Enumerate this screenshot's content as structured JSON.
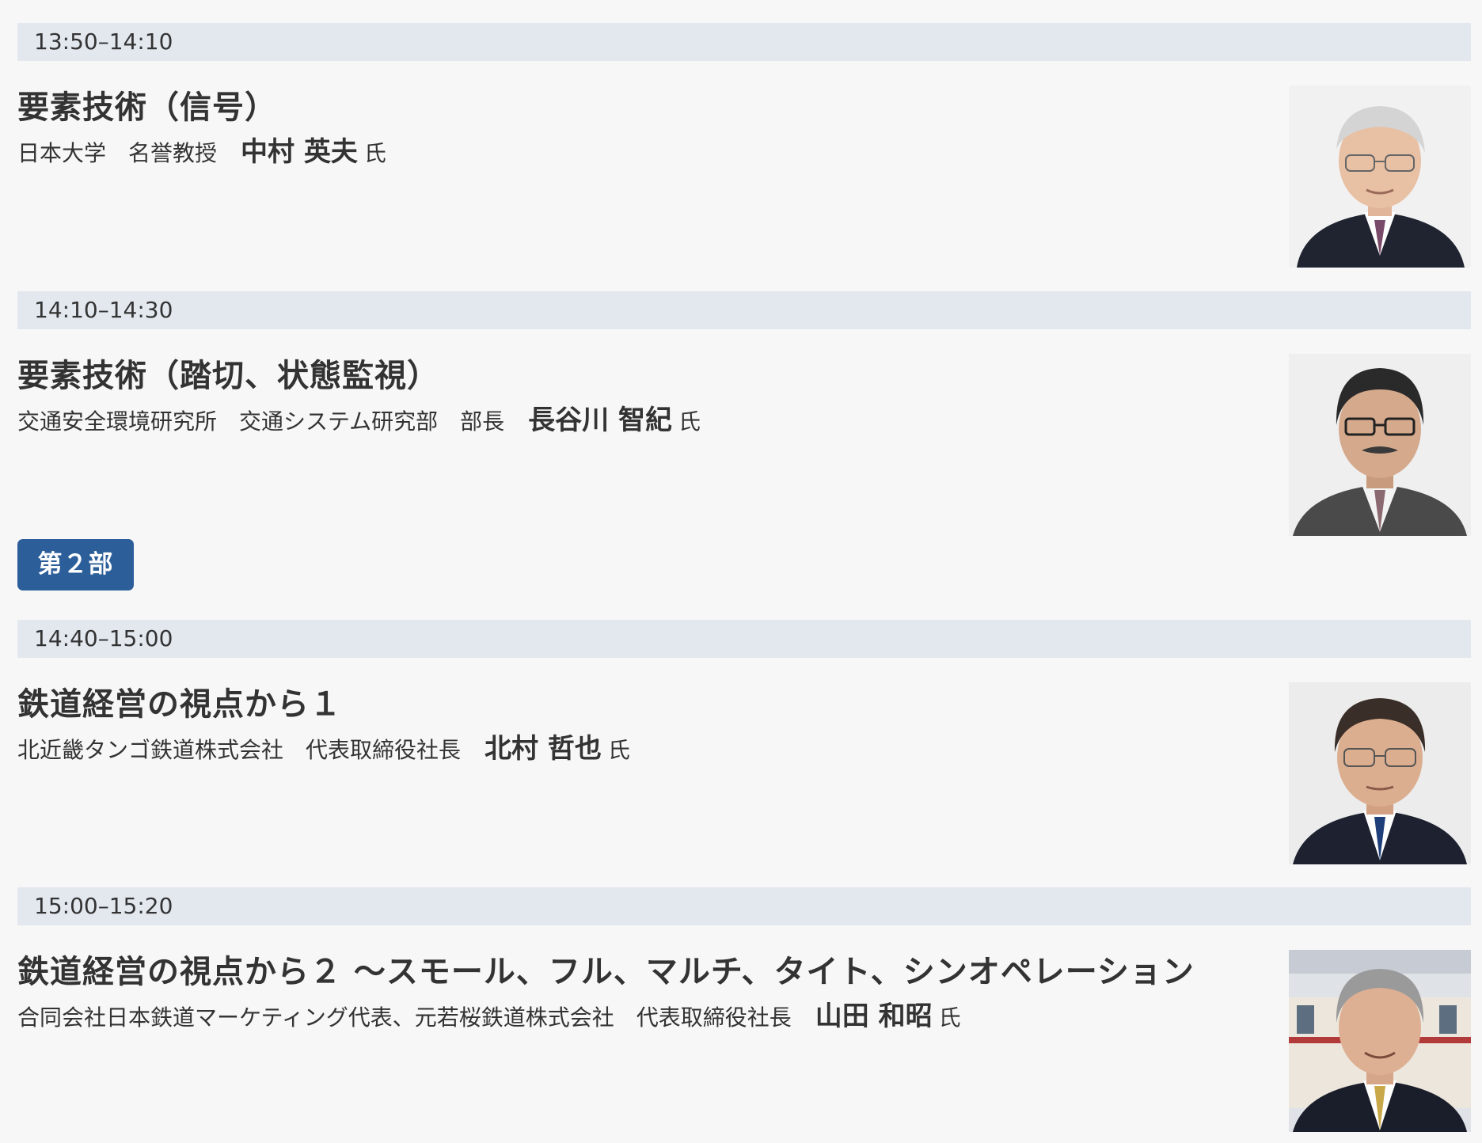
{
  "part_badge": "第２部",
  "sessions": [
    {
      "time": "13:50–14:10",
      "title": "要素技術（信号）",
      "affiliation": "日本大学　名誉教授",
      "name": "中村 英夫",
      "honorific": "氏"
    },
    {
      "time": "14:10–14:30",
      "title": "要素技術（踏切、状態監視）",
      "affiliation": "交通安全環境研究所　交通システム研究部　部長",
      "name": "長谷川 智紀",
      "honorific": "氏"
    },
    {
      "time": "14:40–15:00",
      "title": "鉄道経営の視点から１",
      "affiliation": "北近畿タンゴ鉄道株式会社　代表取締役社長",
      "name": "北村 哲也",
      "honorific": "氏"
    },
    {
      "time": "15:00–15:20",
      "title": "鉄道経営の視点から２ ～スモール、フル、マルチ、タイト、シンオペレーション",
      "affiliation": "合同会社日本鉄道マーケティング代表、元若桜鉄道株式会社　代表取締役社長",
      "name": "山田 和昭",
      "honorific": "氏"
    }
  ],
  "colors": {
    "time_bar": "#e3e8ef",
    "badge": "#2c5e99",
    "text": "#333333",
    "background": "#f7f7f7"
  }
}
